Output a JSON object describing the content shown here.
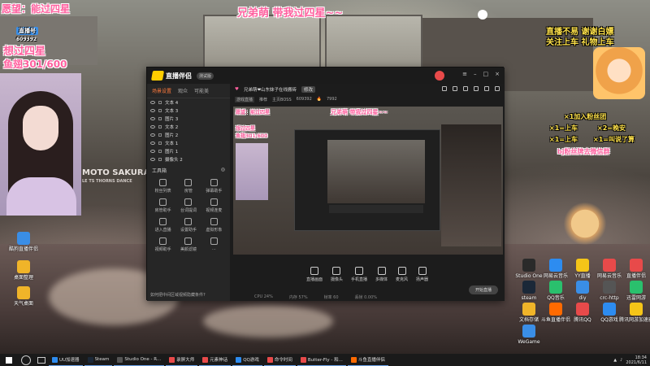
{
  "overlay": {
    "top_left_goal": "愿望：能过四星",
    "top_center": "兄弟萌 带我过四星~~",
    "room_label": "直播号",
    "room_id": "609392",
    "left_line1": "想过四星",
    "left_line2": "鱼翅301/600",
    "right_rules1": "直播不易 谢谢白嫖",
    "right_rules2": "关注上车 礼物上车",
    "rule_join": "×1加入粉丝团",
    "rule_a": "×1=上车",
    "rule_b": "×2=晚安",
    "rule_c": "×1=上车",
    "rule_d": "×1=叫说了算",
    "rule_e": "bj粉丝牌去微信群"
  },
  "webcam": {
    "caption": "MOTO SAKURA",
    "subcaption": "LE TS THORNS DANCE"
  },
  "desktop_icons_left": [
    {
      "label": "酷狗直播伴侣",
      "color": "#3a8ee6"
    },
    {
      "label": "桌面整理",
      "color": "#f0b429"
    },
    {
      "label": "天气桌面",
      "color": "#f0b429"
    }
  ],
  "desktop_icons_right": [
    {
      "label": "Studio One",
      "color": "#2a2a2a"
    },
    {
      "label": "网易云音乐",
      "color": "#2d8cf0"
    },
    {
      "label": "YY直播",
      "color": "#f5c518"
    },
    {
      "label": "网易云音乐",
      "color": "#e84a4a"
    },
    {
      "label": "直播伴侣",
      "color": "#e84a4a"
    },
    {
      "label": "steam",
      "color": "#1b2838"
    },
    {
      "label": "QQ音乐",
      "color": "#2ac06d"
    },
    {
      "label": "diy",
      "color": "#3a8ee6"
    },
    {
      "label": "crc-http",
      "color": "#555555"
    },
    {
      "label": "迅雷网游",
      "color": "#2ac06d"
    },
    {
      "label": "文档存储",
      "color": "#f0b429"
    },
    {
      "label": "斗鱼直播伴侣",
      "color": "#ff6a00"
    },
    {
      "label": "腾讯QQ",
      "color": "#e84a4a"
    },
    {
      "label": "QQ游戏",
      "color": "#2d8cf0"
    },
    {
      "label": "腾讯网游加速器",
      "color": "#f5c518"
    },
    {
      "label": "WeGame",
      "color": "#3a8ee6"
    }
  ],
  "app": {
    "title": "直播伴侣",
    "version": "测试版",
    "sidebar_tabs": [
      "场景设置",
      "观众",
      "可能美"
    ],
    "scenes": [
      "文本 4",
      "文本 3",
      "图片 3",
      "文本 2",
      "图片 2",
      "文本 1",
      "图片 1",
      "摄像头 2"
    ],
    "tools_title": "工具箱",
    "tools": [
      "粉丝列表",
      "房管",
      "弹幕助手",
      "房管助手",
      "台词提词",
      "视频连麦",
      "进入直播",
      "设置助手",
      "虚拟形象",
      "视频助手",
      "美颜滤镜",
      "..."
    ],
    "bottom_link": "如何把中间区域视频隐藏条件?",
    "stream_title": "兄弟萌❤山东妹子在线搬砖",
    "stream_badge": "修改",
    "category": "游戏直播",
    "tag": "推荐",
    "room": "主页BOSS",
    "room_no": "609392",
    "heat": "7992",
    "preview_goal": "愿望：能过四星",
    "preview_center": "兄弟萌 带我过四星~~",
    "preview_left": "想过四星",
    "preview_fish": "鱼翅301/600",
    "controls": [
      "直播画面",
      "摄像头",
      "手机直播",
      "多媒体",
      "麦克风",
      "扬声器"
    ],
    "start_button": "开始直播",
    "status": [
      "CPU 24%",
      "内存 57%",
      "帧率 60",
      "丢帧 0.00%"
    ]
  },
  "taskbar": {
    "items": [
      {
        "label": "UU加速器",
        "color": "#2d8cf0"
      },
      {
        "label": "Steam",
        "color": "#1b2838"
      },
      {
        "label": "Studio One - R...",
        "color": "#555555"
      },
      {
        "label": "录屏大师",
        "color": "#e84a4a"
      },
      {
        "label": "元素神话",
        "color": "#e84a4a"
      },
      {
        "label": "QQ游戏",
        "color": "#2d8cf0"
      },
      {
        "label": "命令时间",
        "color": "#e84a4a"
      },
      {
        "label": "Butter-Fly - 和...",
        "color": "#e84a4a"
      },
      {
        "label": "斗鱼直播伴侣",
        "color": "#ff6a00"
      }
    ],
    "time": "18:34",
    "date": "2021/6/11"
  }
}
